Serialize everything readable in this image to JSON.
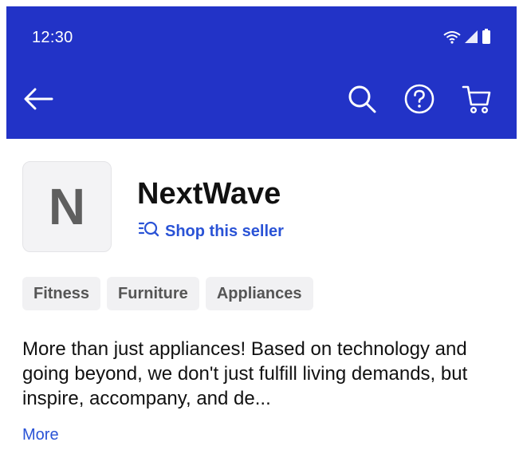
{
  "status_bar": {
    "time": "12:30",
    "icons": [
      "wifi-icon",
      "signal-icon",
      "battery-icon"
    ]
  },
  "toolbar": {
    "back_icon": "arrow-left-icon",
    "actions": [
      "search-icon",
      "help-icon",
      "cart-icon"
    ]
  },
  "seller": {
    "avatar_letter": "N",
    "name": "NextWave",
    "shop_link_label": "Shop this seller",
    "shop_link_icon": "search-list-icon",
    "tags": [
      "Fitness",
      "Furniture",
      "Appliances"
    ],
    "description": "More than just appliances! Based on technology and going beyond, we don't just fulfill living demands, but inspire, accompany, and de...",
    "more_label": "More"
  },
  "colors": {
    "appbar": "#2233c7",
    "link": "#2a53d6",
    "tag_bg": "#f1f1f3"
  }
}
